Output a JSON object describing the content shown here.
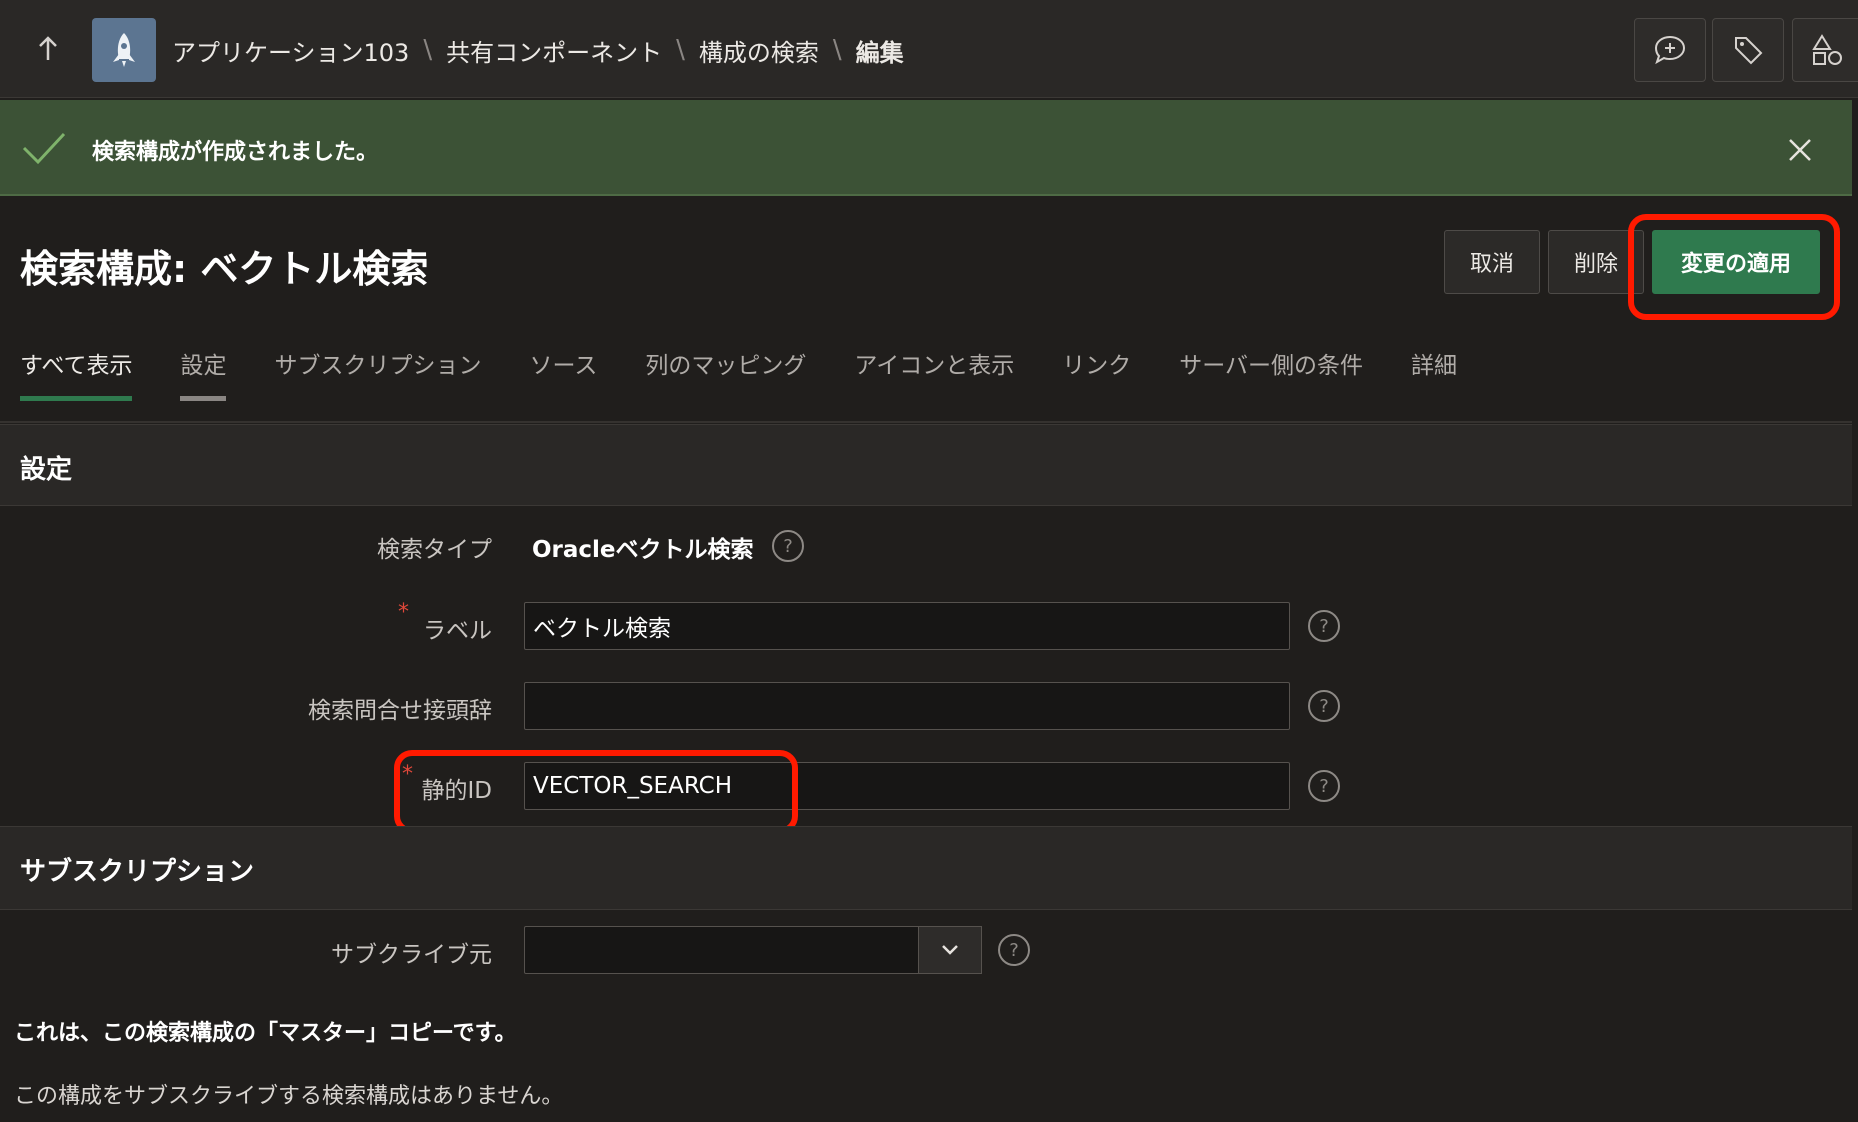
{
  "topbar": {
    "breadcrumbs": [
      "アプリケーション103",
      "共有コンポーネント",
      "構成の検索",
      "編集"
    ],
    "icons": [
      "up-arrow-icon",
      "rocket-icon",
      "comment-add-icon",
      "tag-icon",
      "shapes-icon"
    ]
  },
  "banner": {
    "message": "検索構成が作成されました。",
    "icons": [
      "check-icon",
      "close-icon"
    ]
  },
  "page": {
    "title": "検索構成: ベクトル検索",
    "buttons": {
      "cancel": "取消",
      "delete": "削除",
      "apply": "変更の適用"
    }
  },
  "tabs": [
    "すべて表示",
    "設定",
    "サブスクリプション",
    "ソース",
    "列のマッピング",
    "アイコンと表示",
    "リンク",
    "サーバー側の条件",
    "詳細"
  ],
  "settings": {
    "section_title": "設定",
    "search_type_label": "検索タイプ",
    "search_type_value": "Oracleベクトル検索",
    "label_label": "ラベル",
    "label_value": "ベクトル検索",
    "prefix_label": "検索問合せ接頭辞",
    "prefix_value": "",
    "static_id_label": "静的ID",
    "static_id_value": "VECTOR_SEARCH",
    "required_mark": "*",
    "help_glyph": "?"
  },
  "subscription": {
    "section_title": "サブスクリプション",
    "subscribe_from_label": "サブクライブ元",
    "subscribe_from_value": "",
    "master_note": "これは、この検索構成の「マスター」コピーです。",
    "no_subscribers_note": "この構成をサブスクライブする検索構成はありません。"
  },
  "colors": {
    "background": "#201e1c",
    "banner": "#3c5236",
    "accent_green": "#2f7a4e",
    "highlight_red": "#ff1a00"
  }
}
